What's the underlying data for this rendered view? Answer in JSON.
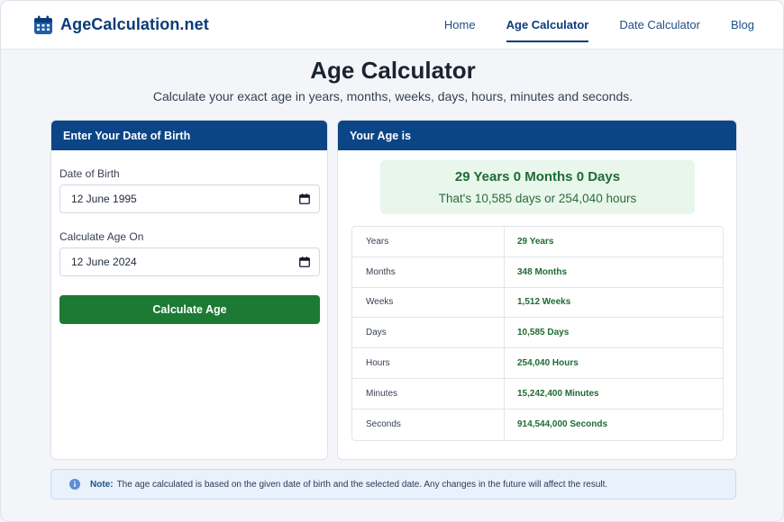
{
  "header": {
    "brand": "AgeCalculation.net",
    "nav": [
      {
        "label": "Home"
      },
      {
        "label": "Age Calculator",
        "active": true
      },
      {
        "label": "Date Calculator"
      },
      {
        "label": "Blog"
      }
    ]
  },
  "main": {
    "title": "Age Calculator",
    "subtitle": "Calculate your exact age in years, months, weeks, days, hours, minutes and seconds."
  },
  "form": {
    "heading": "Enter Your Date of Birth",
    "dob_label": "Date of Birth",
    "dob_value": "12 June 1995",
    "calc_on_label": "Calculate Age On",
    "calc_on_value": "12 June 2024",
    "button_label": "Calculate Age"
  },
  "result": {
    "heading": "Your Age is",
    "main": "29 Years 0 Months 0 Days",
    "sub": "That's 10,585 days or 254,040 hours",
    "rows": [
      {
        "label": "Years",
        "value": "29 Years"
      },
      {
        "label": "Months",
        "value": "348 Months"
      },
      {
        "label": "Weeks",
        "value": "1,512 Weeks"
      },
      {
        "label": "Days",
        "value": "10,585 Days"
      },
      {
        "label": "Hours",
        "value": "254,040 Hours"
      },
      {
        "label": "Minutes",
        "value": "15,242,400 Minutes"
      },
      {
        "label": "Seconds",
        "value": "914,544,000 Seconds"
      }
    ]
  },
  "note": {
    "prefix": "Note:",
    "text": "The age calculated is based on the given date of birth and the selected date. Any changes in the future will affect the result."
  },
  "icons": {
    "brand": "calendar-icon",
    "date_field": "calendar-icon",
    "note": "info-icon"
  },
  "colors": {
    "primary": "#0b4585",
    "brand_text": "#0b3b78",
    "button": "#1c7a34",
    "result_bg": "#e8f6ec",
    "result_text": "#1e6b33",
    "note_bg": "#e8f1fc"
  }
}
